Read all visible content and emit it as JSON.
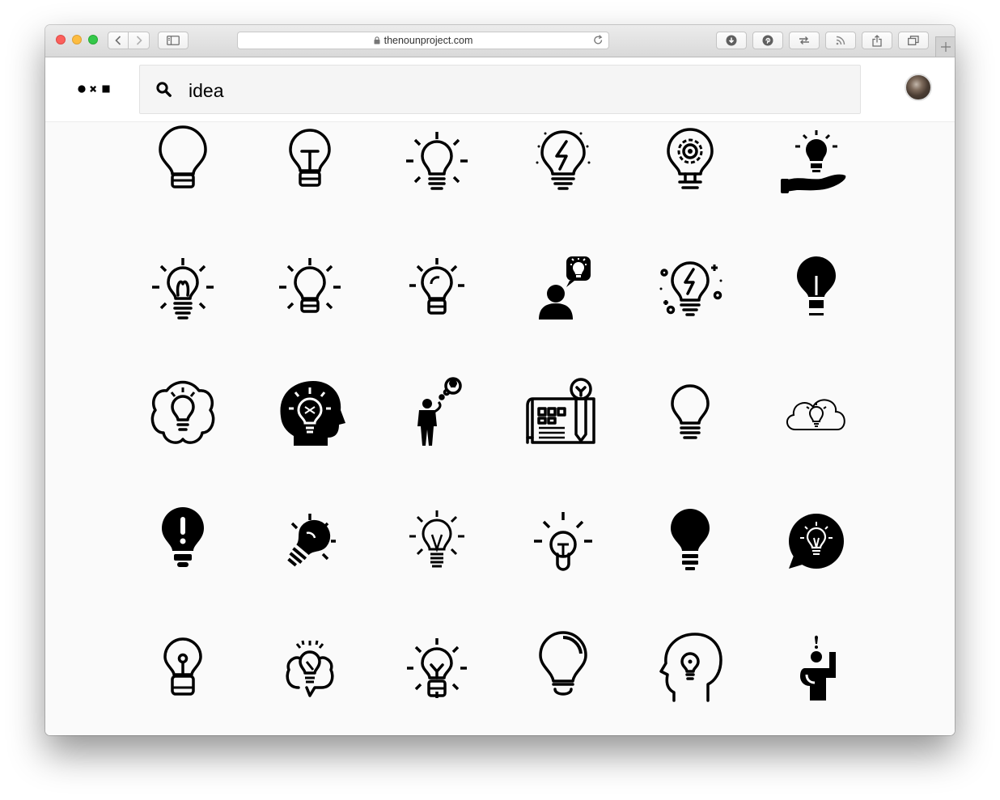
{
  "browser": {
    "url": "thenounproject.com"
  },
  "search": {
    "query": "idea"
  },
  "icons": [
    "lightbulb-outline-icon",
    "lightbulb-filament-icon",
    "lightbulb-shining-icon",
    "lightbulb-lightning-icon",
    "lightbulb-gear-icon",
    "hand-holding-lightbulb-icon",
    "lightbulb-rays-icon",
    "lightbulb-glow-icon",
    "lightbulb-rays-small-icon",
    "person-thinking-idea-icon",
    "lightbulb-sparkles-icon",
    "lightbulb-solid-icon",
    "brain-lightbulb-icon",
    "head-lightbulb-icon",
    "businessman-idea-icon",
    "blueprint-pencil-idea-icon",
    "lightbulb-thin-icon",
    "cloud-lightbulb-icon",
    "lightbulb-exclamation-icon",
    "lightbulb-tilted-shining-icon",
    "lightbulb-filament-rays-icon",
    "lightbulb-round-rays-icon",
    "lightbulb-black-icon",
    "speech-bubble-lightbulb-icon",
    "lightbulb-key-icon",
    "speech-bubble-idea-icon",
    "lightbulb-y-rays-icon",
    "lightbulb-glossy-icon",
    "head-profile-lightbulb-icon",
    "person-raising-hand-idea-icon"
  ]
}
